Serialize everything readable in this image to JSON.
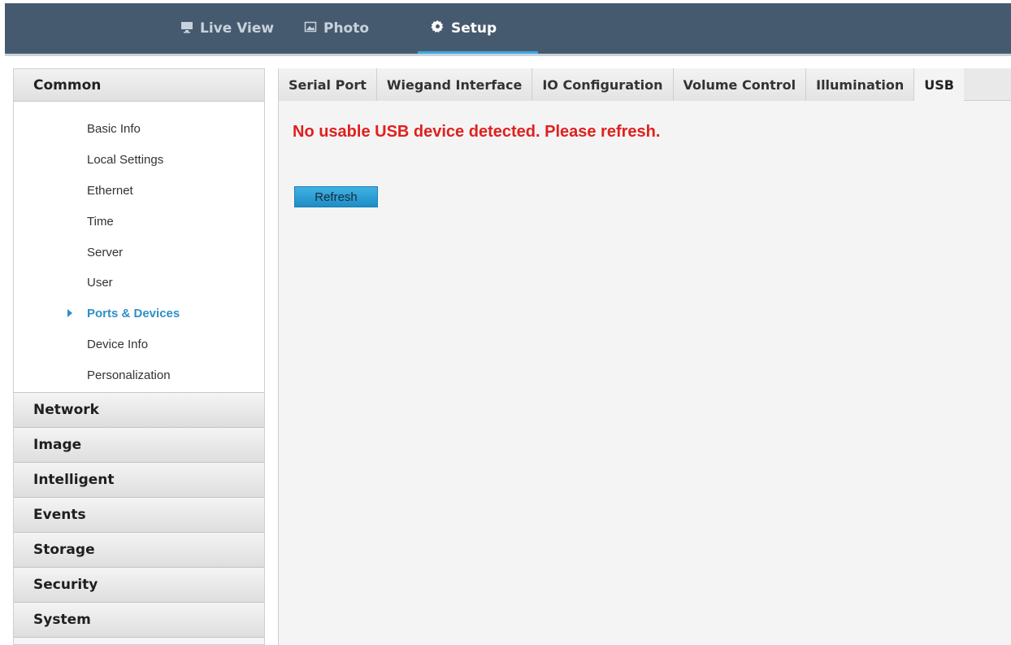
{
  "topnav": {
    "items": [
      {
        "label": "Live View",
        "icon": "monitor-icon"
      },
      {
        "label": "Photo",
        "icon": "image-icon"
      },
      {
        "label": "Setup",
        "icon": "gear-icon"
      }
    ],
    "active": "Setup"
  },
  "sidebar": {
    "common_label": "Common",
    "common_items": [
      {
        "label": "Basic Info"
      },
      {
        "label": "Local Settings"
      },
      {
        "label": "Ethernet"
      },
      {
        "label": "Time"
      },
      {
        "label": "Server"
      },
      {
        "label": "User"
      },
      {
        "label": "Ports & Devices"
      },
      {
        "label": "Device Info"
      },
      {
        "label": "Personalization"
      }
    ],
    "active_item": "Ports & Devices",
    "groups": [
      {
        "label": "Network"
      },
      {
        "label": "Image"
      },
      {
        "label": "Intelligent"
      },
      {
        "label": "Events"
      },
      {
        "label": "Storage"
      },
      {
        "label": "Security"
      },
      {
        "label": "System"
      }
    ]
  },
  "tabs": [
    {
      "label": "Serial Port"
    },
    {
      "label": "Wiegand Interface"
    },
    {
      "label": "IO Configuration"
    },
    {
      "label": "Volume Control"
    },
    {
      "label": "Illumination"
    },
    {
      "label": "USB"
    }
  ],
  "active_tab": "USB",
  "main": {
    "message": "No usable USB device detected. Please refresh.",
    "refresh_label": "Refresh"
  },
  "colors": {
    "topbar": "#465a6f",
    "accent": "#3aa9e0",
    "error": "#e0201e",
    "active_link": "#2f8fc8"
  }
}
